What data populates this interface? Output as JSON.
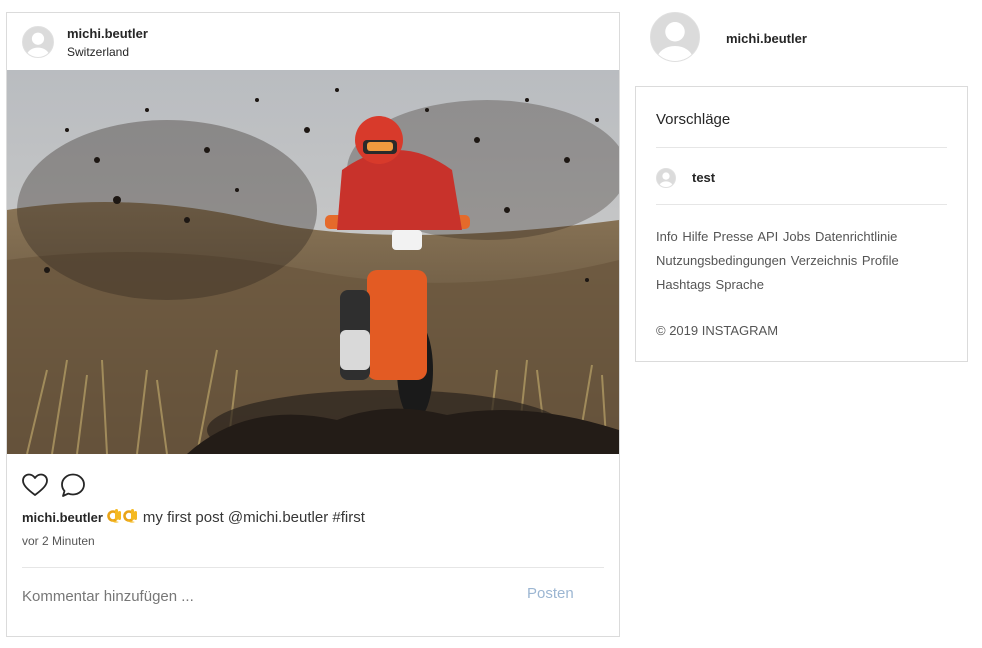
{
  "post": {
    "username": "michi.beutler",
    "location": "Switzerland",
    "caption_author": "michi.beutler",
    "caption_emoji": "👌👌",
    "caption_text": "my first post @michi.beutler #first",
    "timestamp": "vor 2 Minuten",
    "comment_placeholder": "Kommentar hinzufügen ...",
    "post_button": "Posten",
    "like_icon": "heart-icon",
    "comment_icon": "speech-bubble-icon"
  },
  "sidebar": {
    "username": "michi.beutler",
    "suggestions_title": "Vorschläge",
    "suggestions": [
      {
        "name": "test"
      }
    ],
    "footer_links": [
      "Info",
      "Hilfe",
      "Presse",
      "API",
      "Jobs",
      "Datenrichtlinie",
      "Nutzungsbedingungen",
      "Verzeichnis",
      "Profile",
      "Hashtags",
      "Sprache"
    ],
    "copyright": "© 2019 INSTAGRAM"
  },
  "colors": {
    "border": "#dbdbdb",
    "text": "#262626",
    "muted": "#555555",
    "post_button": "#9cb6d2"
  }
}
